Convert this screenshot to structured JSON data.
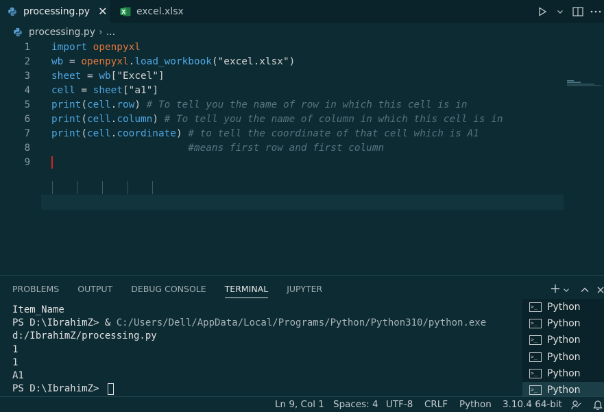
{
  "tabs": [
    {
      "label": "processing.py",
      "active": true
    },
    {
      "label": "excel.xlsx",
      "active": false
    }
  ],
  "tab_close_glyph": "✕",
  "breadcrumb": {
    "file": "processing.py",
    "rest": "..."
  },
  "editor": {
    "line_numbers": [
      "1",
      "2",
      "3",
      "4",
      "5",
      "6",
      "7",
      "8",
      "9"
    ]
  },
  "panel": {
    "tabs": [
      "PROBLEMS",
      "OUTPUT",
      "DEBUG CONSOLE",
      "TERMINAL",
      "JUPYTER"
    ],
    "active_tab": "TERMINAL"
  },
  "terminal": {
    "line1": "Item_Name",
    "line2_prompt": "PS D:\\IbrahimZ> & ",
    "line2_path": "C:/Users/Dell/AppData/Local/Programs/Python/Python310/python.exe",
    "line3": "d:/IbrahimZ/processing.py",
    "line4": "1",
    "line5": "1",
    "line6": "A1",
    "line7": "PS D:\\IbrahimZ> "
  },
  "terminal_list": [
    "Python",
    "Python",
    "Python",
    "Python",
    "Python",
    "Python"
  ],
  "statusbar": {
    "position": "Ln 9, Col 1",
    "spaces": "Spaces: 4",
    "encoding": "UTF-8",
    "eol": "CRLF",
    "language": "Python",
    "interpreter": "3.10.4 64-bit"
  },
  "colors": {
    "keyword": "#4fa6e0",
    "module": "#e0783c",
    "comment": "#55747d",
    "background": "#0d2b33",
    "cursor": "#d42525"
  }
}
